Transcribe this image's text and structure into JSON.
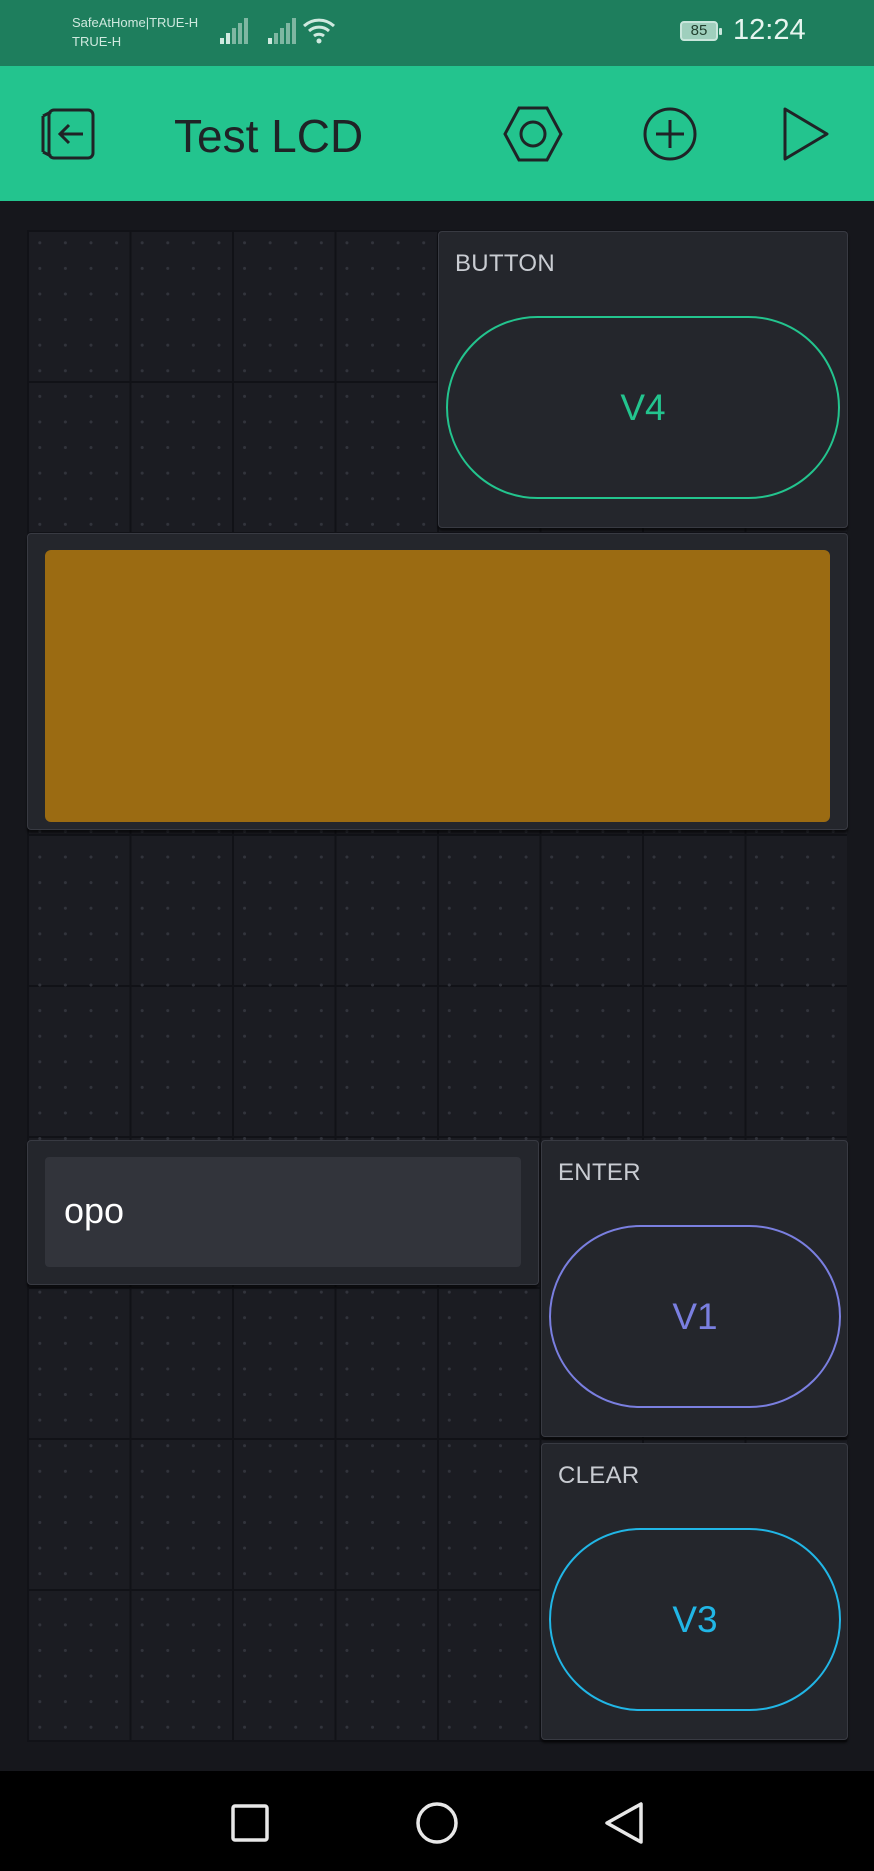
{
  "status_bar": {
    "carrier_line1": "SafeAtHome|TRUE-H",
    "carrier_line2": "TRUE-H",
    "battery": "85",
    "time": "12:24"
  },
  "toolbar": {
    "title": "Test LCD",
    "icons": [
      "exit-icon",
      "settings-hex-icon",
      "add-icon",
      "play-icon"
    ]
  },
  "widgets": {
    "button_v4": {
      "label": "BUTTON",
      "pin": "V4",
      "color": "#23c48e"
    },
    "lcd": {
      "color": "#9b6b12"
    },
    "terminal": {
      "value": "opo"
    },
    "button_enter": {
      "label": "ENTER",
      "pin": "V1",
      "color": "#7a7fe0"
    },
    "button_clear": {
      "label": "CLEAR",
      "pin": "V3",
      "color": "#21b6e6"
    }
  },
  "nav_bar": {
    "icons": [
      "recent-apps-icon",
      "home-icon",
      "back-icon"
    ]
  }
}
